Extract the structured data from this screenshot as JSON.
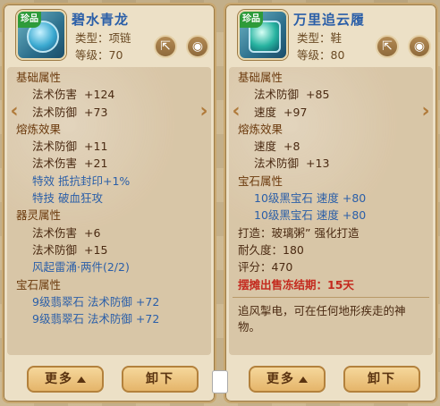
{
  "left": {
    "badge": "珍品",
    "name": "碧水青龙",
    "type": "类型：项链",
    "level": "等级：70",
    "sections": {
      "base_title": "基础属性",
      "base": [
        {
          "name": "法术伤害",
          "value": "+124"
        },
        {
          "name": "法术防御",
          "value": "+73"
        }
      ],
      "refine_title": "熔炼效果",
      "refine": [
        {
          "name": "法术防御",
          "value": "+11"
        },
        {
          "name": "法术伤害",
          "value": "+21"
        }
      ],
      "special_effect": "特效  抵抗封印+1%",
      "special_skill": "特技  破血狂攻",
      "spirit_title": "器灵属性",
      "spirit": [
        {
          "name": "法术伤害",
          "value": "+6"
        },
        {
          "name": "法术防御",
          "value": "+15"
        }
      ],
      "spirit_set": "风起雷涌·两件(2/2)",
      "gem_title": "宝石属性",
      "gems": [
        "9级翡翠石  法术防御  +72",
        "9级翡翠石  法术防御  +72"
      ]
    },
    "buttons": {
      "more": "更多",
      "unequip": "卸下"
    }
  },
  "right": {
    "badge": "珍品",
    "name": "万里追云履",
    "type": "类型：鞋",
    "level": "等级：80",
    "sections": {
      "base_title": "基础属性",
      "base": [
        {
          "name": "法术防御",
          "value": "+85"
        },
        {
          "name": "速度",
          "value": "+97"
        }
      ],
      "refine_title": "熔炼效果",
      "refine": [
        {
          "name": "速度",
          "value": "+8"
        },
        {
          "name": "法术防御",
          "value": "+13"
        }
      ],
      "gem_title": "宝石属性",
      "gems": [
        "10级黑宝石  速度  +80",
        "10级黑宝石  速度  +80"
      ],
      "forge": "打造：玻璃粥”   强化打造",
      "durability": "耐久度：180",
      "score": "评分：470",
      "warning": "摆摊出售冻结期：15天",
      "description": "追风掣电，可在任何地形疾走的神物。"
    },
    "buttons": {
      "more": "更多",
      "unequip": "卸下"
    }
  },
  "icons": {
    "share": "share-icon",
    "view": "eye-icon",
    "prev": "chevron-left-icon",
    "next": "chevron-right-icon"
  }
}
